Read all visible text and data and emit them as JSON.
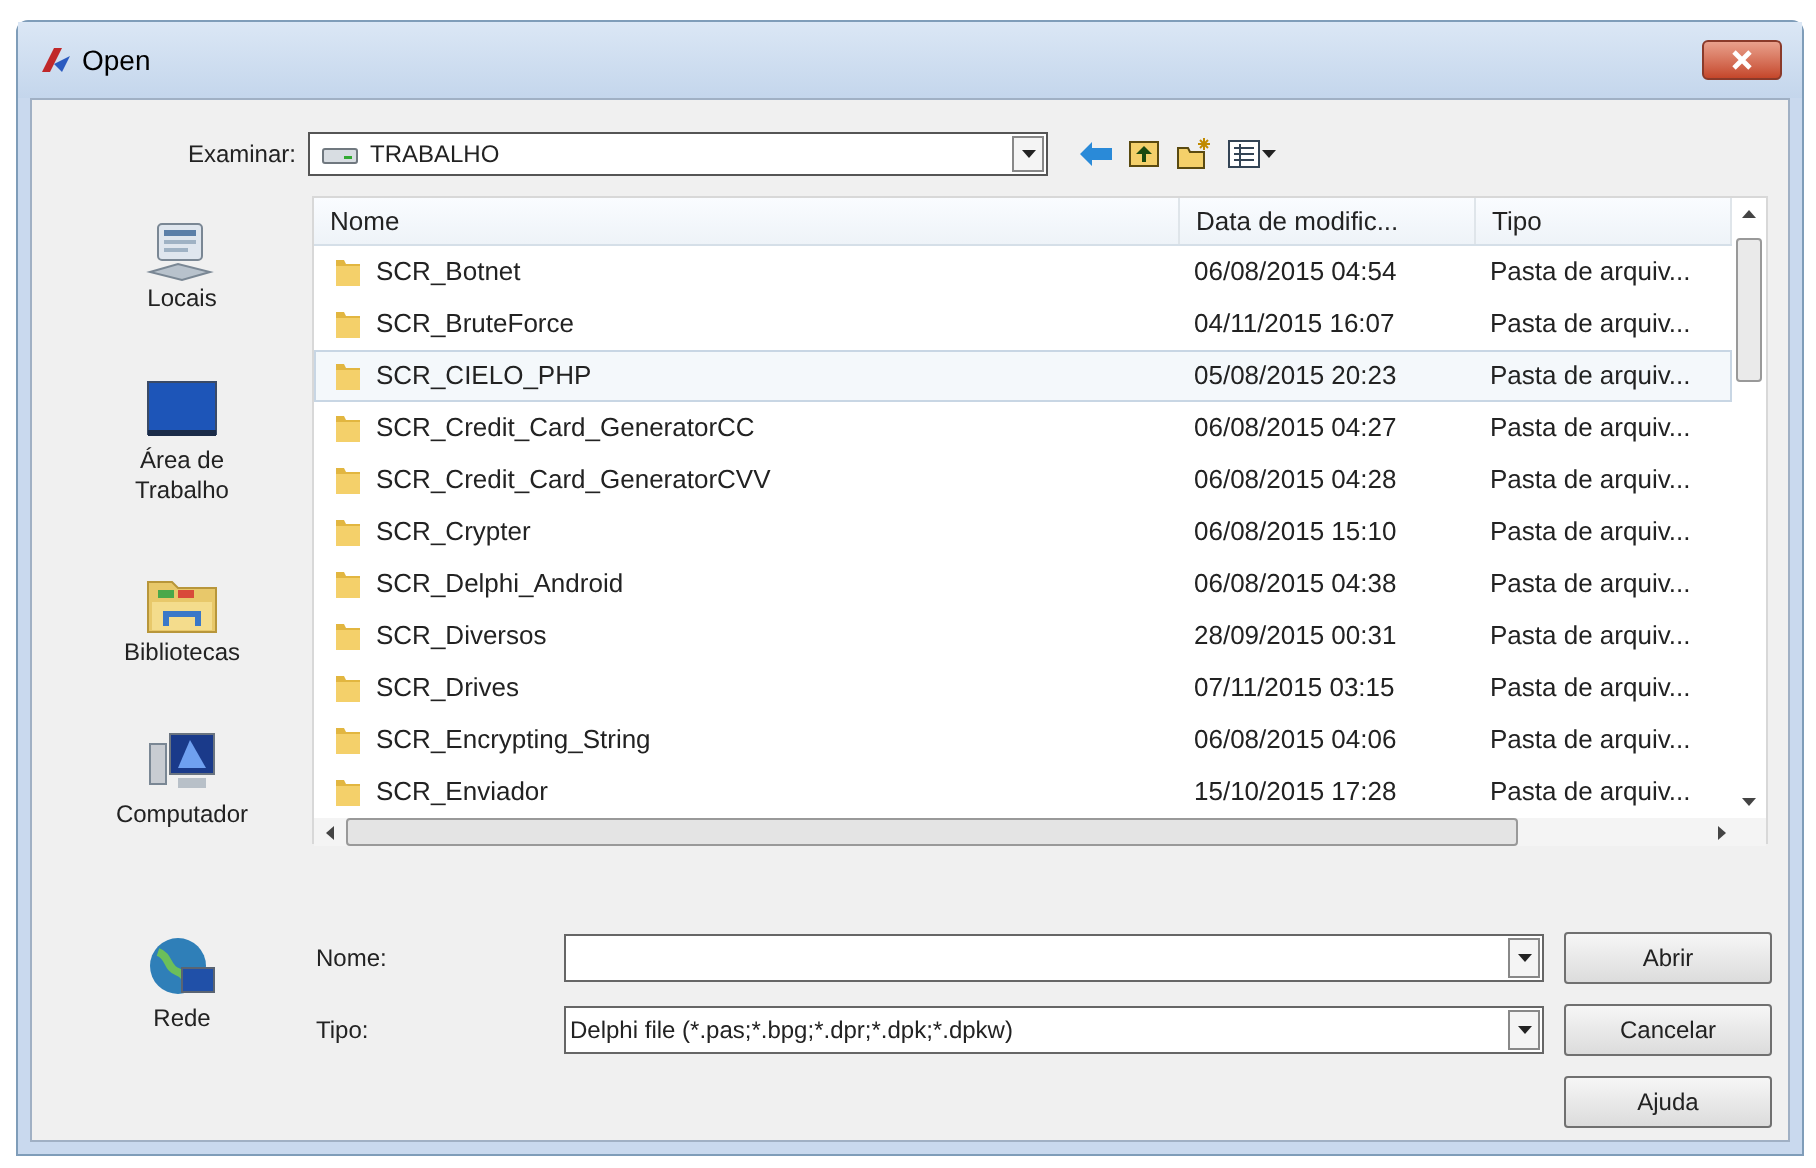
{
  "window": {
    "title": "Open"
  },
  "location": {
    "label": "Examinar:",
    "value": "TRABALHO"
  },
  "places": [
    {
      "label": "Locais",
      "kind": "recent"
    },
    {
      "label": "Área de Trabalho",
      "kind": "desktop"
    },
    {
      "label": "Bibliotecas",
      "kind": "libraries"
    },
    {
      "label": "Computador",
      "kind": "computer"
    },
    {
      "label": "Rede",
      "kind": "network"
    }
  ],
  "table": {
    "columns": [
      "Nome",
      "Data de modific...",
      "Tipo"
    ],
    "rows": [
      {
        "name": "SCR_Botnet",
        "date": "06/08/2015 04:54",
        "type": "Pasta de arquiv...",
        "selected": false
      },
      {
        "name": "SCR_BruteForce",
        "date": "04/11/2015 16:07",
        "type": "Pasta de arquiv...",
        "selected": false
      },
      {
        "name": "SCR_CIELO_PHP",
        "date": "05/08/2015 20:23",
        "type": "Pasta de arquiv...",
        "selected": true
      },
      {
        "name": "SCR_Credit_Card_GeneratorCC",
        "date": "06/08/2015 04:27",
        "type": "Pasta de arquiv...",
        "selected": false
      },
      {
        "name": "SCR_Credit_Card_GeneratorCVV",
        "date": "06/08/2015 04:28",
        "type": "Pasta de arquiv...",
        "selected": false
      },
      {
        "name": "SCR_Crypter",
        "date": "06/08/2015 15:10",
        "type": "Pasta de arquiv...",
        "selected": false
      },
      {
        "name": "SCR_Delphi_Android",
        "date": "06/08/2015 04:38",
        "type": "Pasta de arquiv...",
        "selected": false
      },
      {
        "name": "SCR_Diversos",
        "date": "28/09/2015 00:31",
        "type": "Pasta de arquiv...",
        "selected": false
      },
      {
        "name": "SCR_Drives",
        "date": "07/11/2015 03:15",
        "type": "Pasta de arquiv...",
        "selected": false
      },
      {
        "name": "SCR_Encrypting_String",
        "date": "06/08/2015 04:06",
        "type": "Pasta de arquiv...",
        "selected": false
      },
      {
        "name": "SCR_Enviador",
        "date": "15/10/2015 17:28",
        "type": "Pasta de arquiv...",
        "selected": false
      }
    ]
  },
  "filename": {
    "label": "Nome:"
  },
  "filetype": {
    "label": "Tipo:",
    "value": "Delphi file (*.pas;*.bpg;*.dpr;*.dpk;*.dpkw)"
  },
  "buttons": [
    "Abrir",
    "Cancelar",
    "Ajuda"
  ]
}
